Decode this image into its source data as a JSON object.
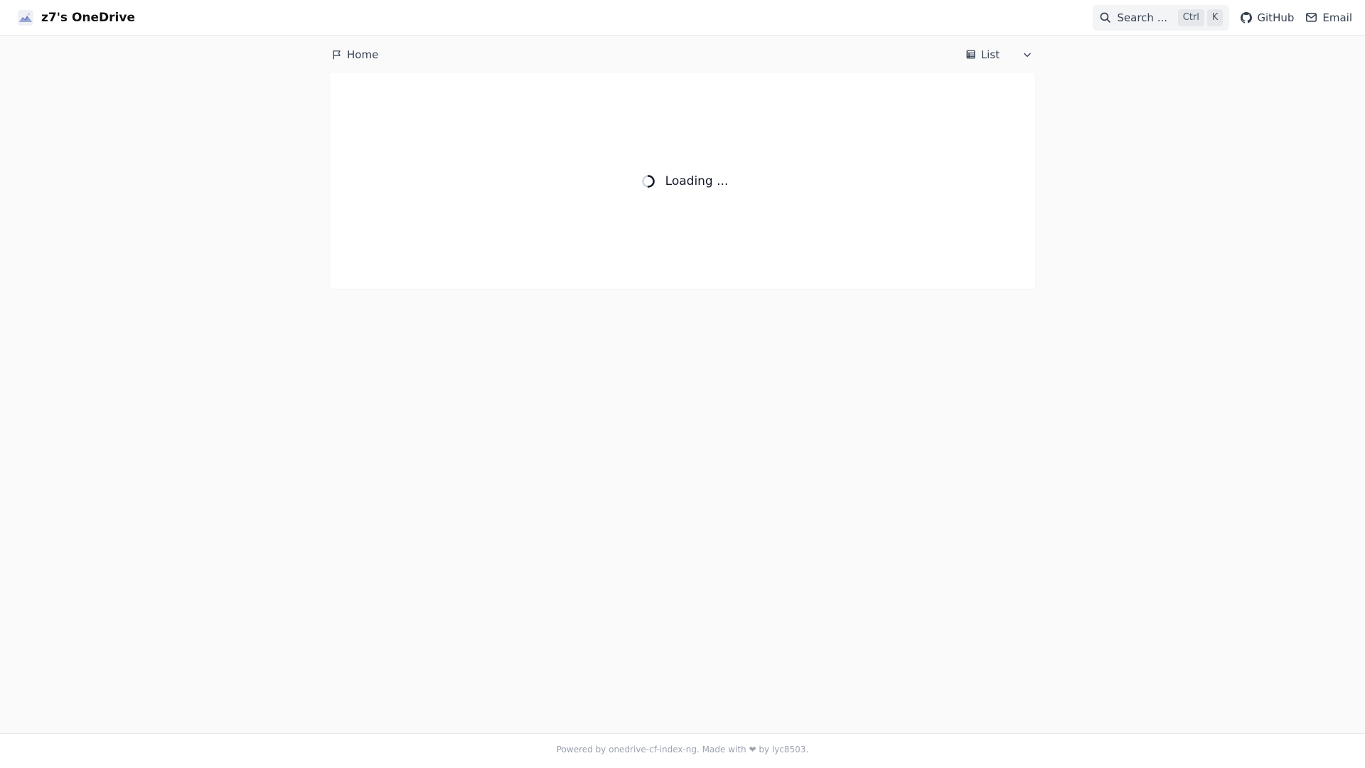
{
  "header": {
    "site_title": "z7's OneDrive",
    "search": {
      "placeholder": "Search ...",
      "shortcut_keys": [
        "Ctrl",
        "K"
      ]
    },
    "links": [
      {
        "label": "GitHub",
        "icon": "github-icon"
      },
      {
        "label": "Email",
        "icon": "mail-icon"
      }
    ]
  },
  "breadcrumb": {
    "home_label": "Home",
    "icon": "flag-icon"
  },
  "view_switch": {
    "label": "List",
    "icon": "list-icon",
    "dropdown_icon": "chevron-down-icon"
  },
  "status": {
    "loading_text": "Loading ..."
  },
  "footer": {
    "prefix": "Powered by ",
    "project_link": "onedrive-cf-index-ng",
    "middle": ". Made with ❤ by ",
    "author_link": "lyc8503",
    "suffix": "."
  },
  "colors": {
    "page_background": "#fafafa",
    "panel_background": "#ffffff",
    "text_primary": "#111827",
    "text_secondary": "#374151",
    "footer_text": "#9ca3af"
  }
}
